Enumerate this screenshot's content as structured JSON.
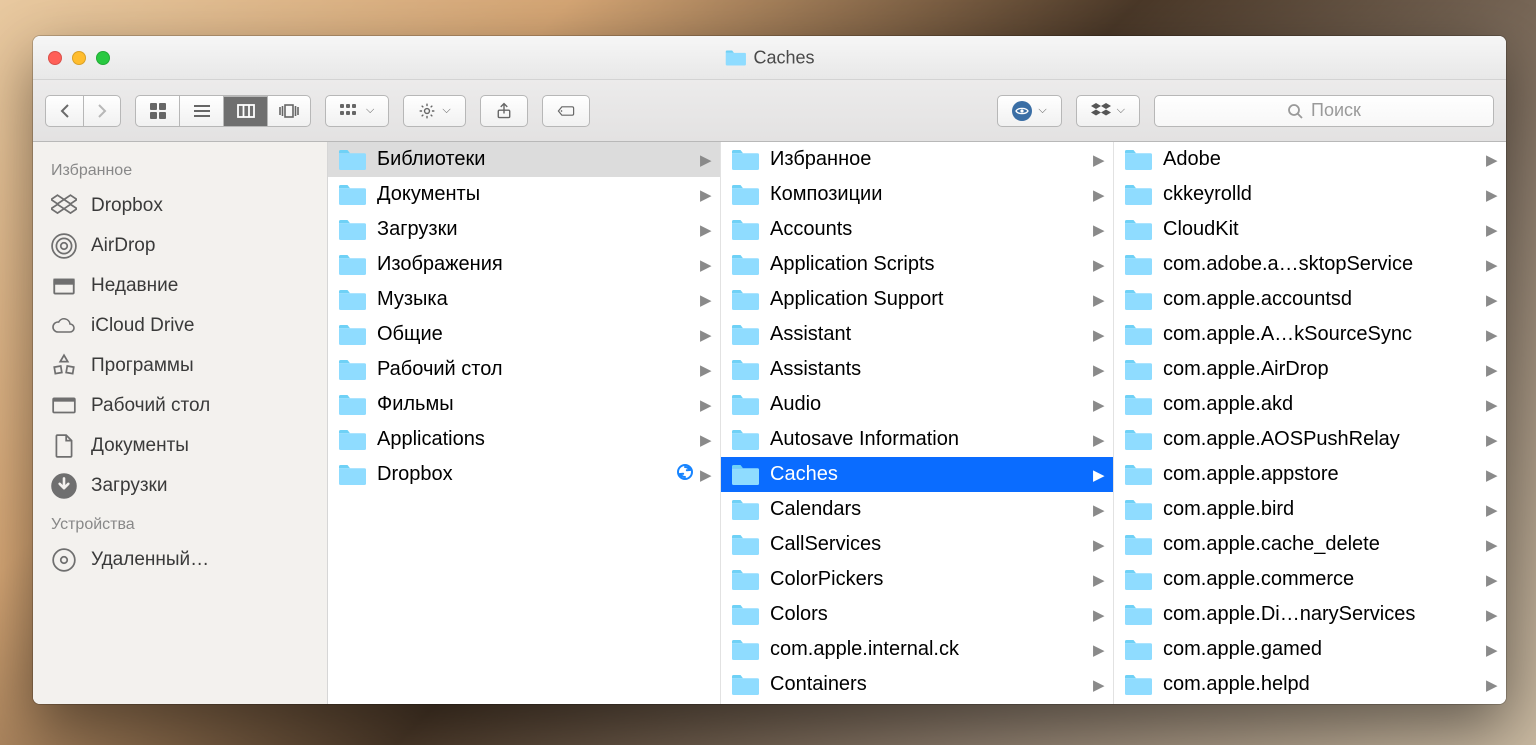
{
  "window": {
    "title": "Caches"
  },
  "search": {
    "placeholder": "Поиск"
  },
  "sidebar": {
    "sections": [
      {
        "title": "Избранное",
        "items": [
          {
            "icon": "dropbox",
            "label": "Dropbox"
          },
          {
            "icon": "airdrop",
            "label": "AirDrop"
          },
          {
            "icon": "recents",
            "label": "Недавние"
          },
          {
            "icon": "cloud",
            "label": "iCloud Drive"
          },
          {
            "icon": "apps",
            "label": "Программы"
          },
          {
            "icon": "desktop",
            "label": "Рабочий стол"
          },
          {
            "icon": "docs",
            "label": "Документы"
          },
          {
            "icon": "downloads",
            "label": "Загрузки"
          }
        ]
      },
      {
        "title": "Устройства",
        "items": [
          {
            "icon": "disk",
            "label": "Удаленный…"
          }
        ]
      }
    ]
  },
  "columns": [
    {
      "items": [
        {
          "label": "Библиотеки",
          "arrow": true,
          "state": "path"
        },
        {
          "label": "Документы",
          "arrow": true
        },
        {
          "label": "Загрузки",
          "arrow": true
        },
        {
          "label": "Изображения",
          "arrow": true
        },
        {
          "label": "Музыка",
          "arrow": true
        },
        {
          "label": "Общие",
          "arrow": true
        },
        {
          "label": "Рабочий стол",
          "arrow": true
        },
        {
          "label": "Фильмы",
          "arrow": true
        },
        {
          "label": "Applications",
          "arrow": true
        },
        {
          "label": "Dropbox",
          "arrow": true,
          "sync": true
        }
      ]
    },
    {
      "items": [
        {
          "label": "Избранное",
          "arrow": true
        },
        {
          "label": "Композиции",
          "arrow": true
        },
        {
          "label": "Accounts",
          "arrow": true
        },
        {
          "label": "Application Scripts",
          "arrow": true
        },
        {
          "label": "Application Support",
          "arrow": true
        },
        {
          "label": "Assistant",
          "arrow": true
        },
        {
          "label": "Assistants",
          "arrow": true
        },
        {
          "label": "Audio",
          "arrow": true
        },
        {
          "label": "Autosave Information",
          "arrow": true
        },
        {
          "label": "Caches",
          "arrow": true,
          "state": "selected"
        },
        {
          "label": "Calendars",
          "arrow": true
        },
        {
          "label": "CallServices",
          "arrow": true
        },
        {
          "label": "ColorPickers",
          "arrow": true
        },
        {
          "label": "Colors",
          "arrow": true
        },
        {
          "label": "com.apple.internal.ck",
          "arrow": true
        },
        {
          "label": "Containers",
          "arrow": true
        }
      ]
    },
    {
      "items": [
        {
          "label": "Adobe",
          "arrow": true
        },
        {
          "label": "ckkeyrolld",
          "arrow": true
        },
        {
          "label": "CloudKit",
          "arrow": true
        },
        {
          "label": "com.adobe.a…sktopService",
          "arrow": true
        },
        {
          "label": "com.apple.accountsd",
          "arrow": true
        },
        {
          "label": "com.apple.A…kSourceSync",
          "arrow": true
        },
        {
          "label": "com.apple.AirDrop",
          "arrow": true
        },
        {
          "label": "com.apple.akd",
          "arrow": true
        },
        {
          "label": "com.apple.AOSPushRelay",
          "arrow": true
        },
        {
          "label": "com.apple.appstore",
          "arrow": true
        },
        {
          "label": "com.apple.bird",
          "arrow": true
        },
        {
          "label": "com.apple.cache_delete",
          "arrow": true
        },
        {
          "label": "com.apple.commerce",
          "arrow": true
        },
        {
          "label": "com.apple.Di…naryServices",
          "arrow": true
        },
        {
          "label": "com.apple.gamed",
          "arrow": true
        },
        {
          "label": "com.apple.helpd",
          "arrow": true
        }
      ]
    }
  ]
}
